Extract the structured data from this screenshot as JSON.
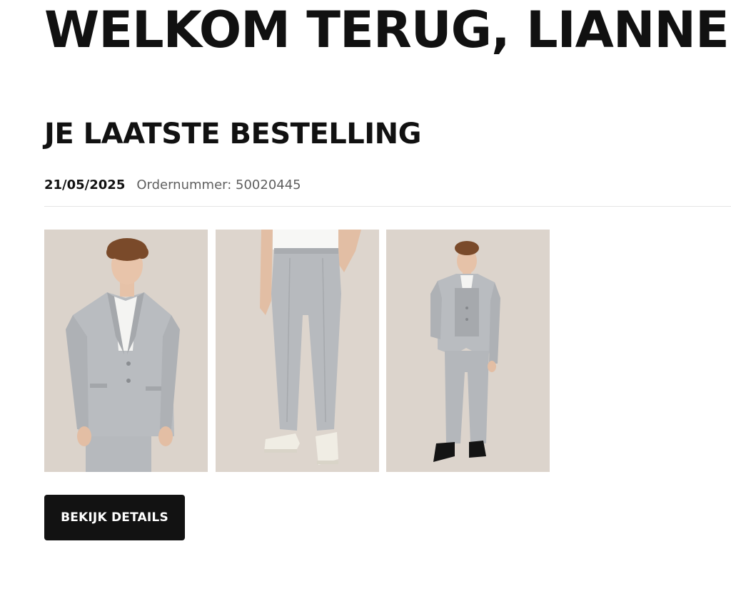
{
  "welcome": {
    "title": "WELKOM TERUG, LIANNE"
  },
  "last_order": {
    "heading": "JE LAATSTE BESTELLING",
    "date": "21/05/2025",
    "order_number_label": "Ordernummer: 50020445",
    "products": [
      {
        "name": "product-image-blazer",
        "description_icon": "blazer-photo"
      },
      {
        "name": "product-image-trousers",
        "description_icon": "trousers-photo"
      },
      {
        "name": "product-image-full-suit",
        "description_icon": "suit-photo"
      }
    ],
    "details_button_label": "BEKIJK DETAILS"
  },
  "colors": {
    "background": "#ffffff",
    "text": "#111111",
    "muted_text": "#5f5f5f",
    "button_bg": "#121212",
    "photo_bg": "#dcd4cc",
    "suit_grey": "#b9bcc0"
  }
}
